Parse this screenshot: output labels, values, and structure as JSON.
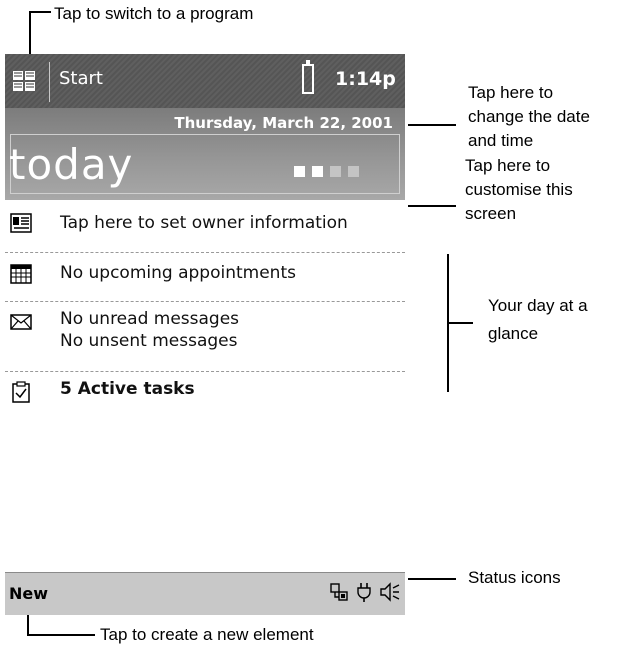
{
  "annotations": {
    "switch_program": "Tap to switch to a program",
    "change_date_line1": "Tap here to",
    "change_date_line2": "change the date",
    "change_date_line3": "and time",
    "customise_line1": "Tap here to",
    "customise_line2": "customise this",
    "customise_line3": "screen",
    "glance_line1": "Your day at a",
    "glance_line2": "glance",
    "status_icons": "Status icons",
    "create_new": "Tap to create a new element"
  },
  "titlebar": {
    "start_label": "Start",
    "time": "1:14p"
  },
  "today": {
    "date": "Thursday, March 22, 2001",
    "title": "today"
  },
  "items": {
    "owner": "Tap here to set owner information",
    "appointments": "No upcoming appointments",
    "messages_unread": "No unread messages",
    "messages_unsent": "No unsent messages",
    "tasks": "5 Active tasks"
  },
  "bottombar": {
    "new_label": "New"
  },
  "icons": {
    "start": "windows-flag-icon",
    "battery": "battery-icon",
    "owner": "contact-card-icon",
    "calendar": "calendar-icon",
    "mail": "envelope-icon",
    "tasks": "clipboard-check-icon",
    "connectivity": "network-icon",
    "power": "plug-icon",
    "volume": "speaker-icon"
  },
  "colors": {
    "titlebar": "#5a5a5a",
    "banner": "#969696",
    "bottombar": "#c8c8c8"
  }
}
